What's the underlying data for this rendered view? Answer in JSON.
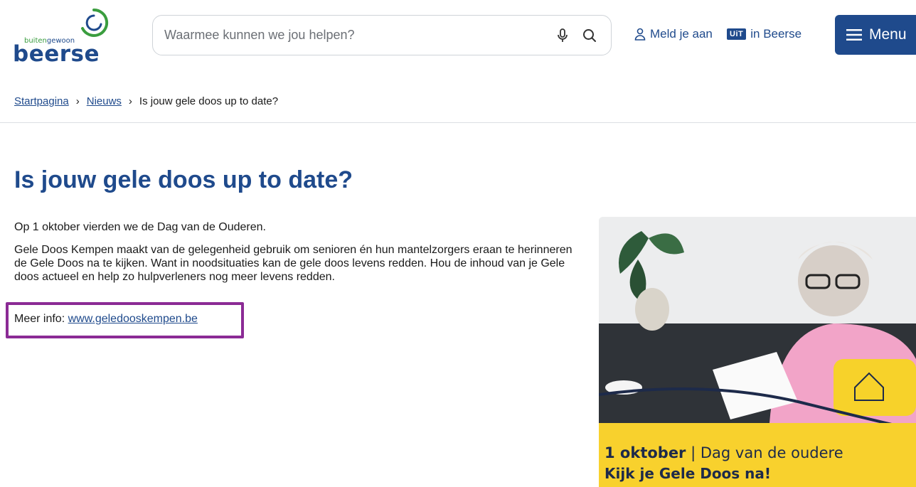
{
  "header": {
    "logo_small_prefix": "buiten",
    "logo_small_suffix": "gewoon",
    "logo_big": "beerse",
    "search_placeholder": "Waarmee kunnen we jou helpen?",
    "login_label": "Meld je aan",
    "uit_badge": "UiT",
    "uit_label": "in Beerse",
    "menu_label": "Menu"
  },
  "breadcrumb": {
    "items": [
      "Startpagina",
      "Nieuws"
    ],
    "current": "Is jouw gele doos up to date?",
    "separator": "›"
  },
  "article": {
    "title": "Is jouw gele doos up to date?",
    "paragraph1": "Op 1 oktober vierden we de Dag van de Ouderen.",
    "paragraph2": "Gele Doos Kempen maakt van de gelegenheid gebruik om senioren én hun mantelzorgers eraan te herinneren de Gele Doos na te kijken. Want in noodsituaties kan de gele doos levens redden. Hou de inhoud van je Gele doos actueel en help zo hulpverleners nog meer levens redden.",
    "more_label": "Meer info:",
    "more_link": "www.geledooskempen.be"
  },
  "promo": {
    "line1_bold": "1 oktober",
    "line1_sep": " | ",
    "line1_rest": "Dag van de oudere",
    "line2": "Kijk je Gele Doos na!"
  },
  "colors": {
    "brand_blue": "#1f4a8c",
    "brand_green": "#3a9d3e",
    "highlight": "#8b2b95",
    "banner_yellow": "#f8d12d"
  },
  "icons": [
    "logo-ring-icon",
    "mic-icon",
    "search-icon",
    "user-icon",
    "hamburger-icon"
  ]
}
